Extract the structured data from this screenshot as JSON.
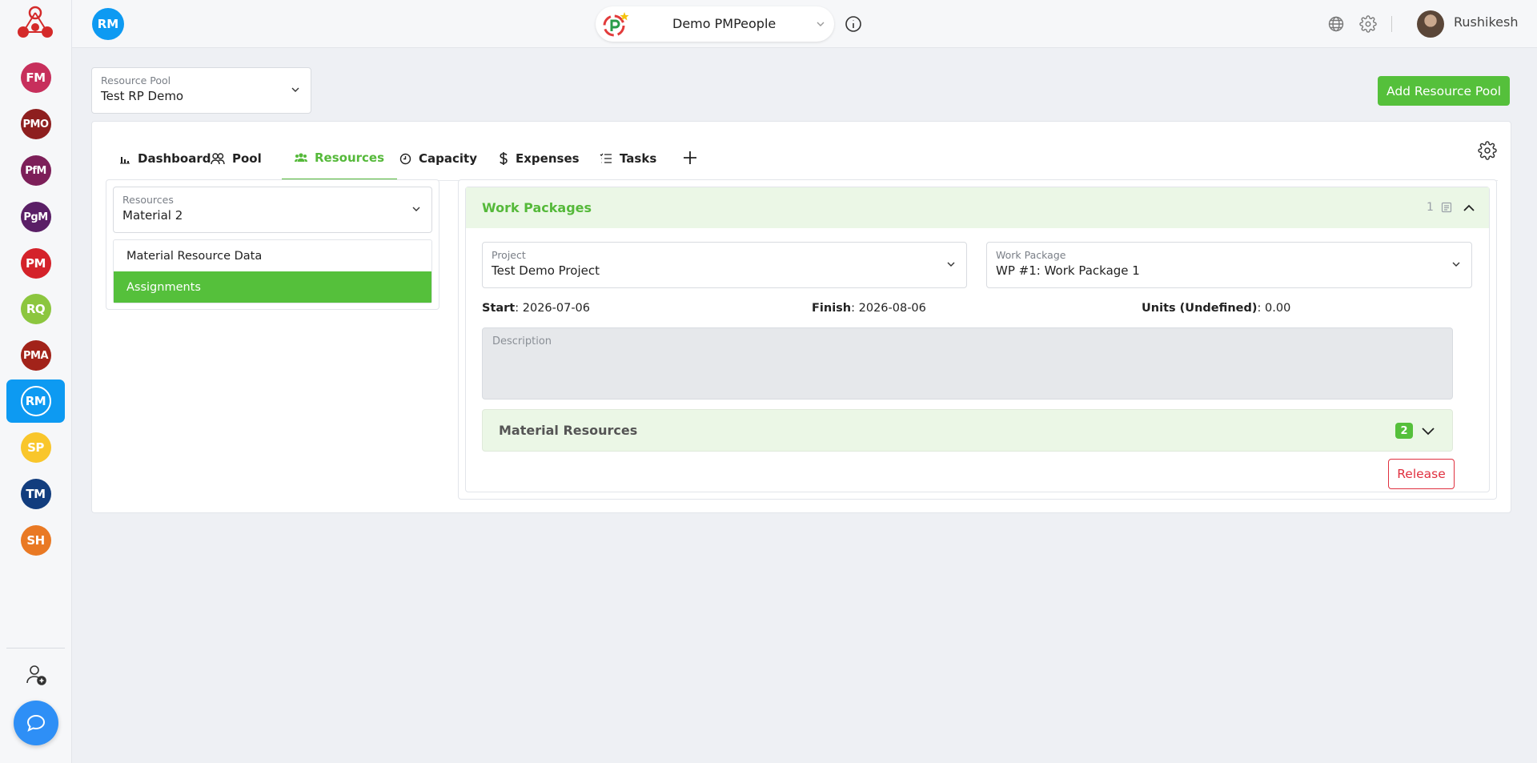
{
  "sidebar": {
    "items": [
      {
        "abbr": "FM",
        "color": "#c72f5c"
      },
      {
        "abbr": "PMO",
        "color": "#8e1f1f"
      },
      {
        "abbr": "PfM",
        "color": "#7d1f59"
      },
      {
        "abbr": "PgM",
        "color": "#5a1f66"
      },
      {
        "abbr": "PM",
        "color": "#d4222a"
      },
      {
        "abbr": "RQ",
        "color": "#8cc63f"
      },
      {
        "abbr": "PMA",
        "color": "#a2231a"
      },
      {
        "abbr": "RM",
        "color": "#0d9af2"
      },
      {
        "abbr": "SP",
        "color": "#f9c62b"
      },
      {
        "abbr": "TM",
        "color": "#123d7e"
      },
      {
        "abbr": "SH",
        "color": "#e97924"
      }
    ]
  },
  "header": {
    "module_badge": "RM",
    "org_name": "Demo PMPeople",
    "user_name": "Rushikesh"
  },
  "resource_pool": {
    "label": "Resource Pool",
    "value": "Test RP Demo"
  },
  "add_pool_label": "Add Resource Pool",
  "tabs": [
    {
      "label": "Dashboard"
    },
    {
      "label": "Pool"
    },
    {
      "label": "Resources"
    },
    {
      "label": "Capacity"
    },
    {
      "label": "Expenses"
    },
    {
      "label": "Tasks"
    }
  ],
  "left_panel": {
    "resources_label": "Resources",
    "resources_value": "Material 2",
    "menu": [
      "Material Resource Data",
      "Assignments"
    ]
  },
  "work_packages": {
    "title": "Work Packages",
    "count": "1",
    "project_label": "Project",
    "project_value": "Test Demo Project",
    "wp_label": "Work Package",
    "wp_value": "WP #1: Work Package 1",
    "start_label": "Start",
    "start_value": ": 2026-07-06",
    "finish_label": "Finish",
    "finish_value": ": 2026-08-06",
    "units_label": "Units (Undefined)",
    "units_value": ": 0.00",
    "description_label": "Description",
    "material_title": "Material Resources",
    "material_count": "2",
    "release_label": "Release"
  },
  "colors": {
    "accent_green": "#55c03b",
    "accent_blue": "#0d9af2",
    "release_red": "#e0303f"
  }
}
